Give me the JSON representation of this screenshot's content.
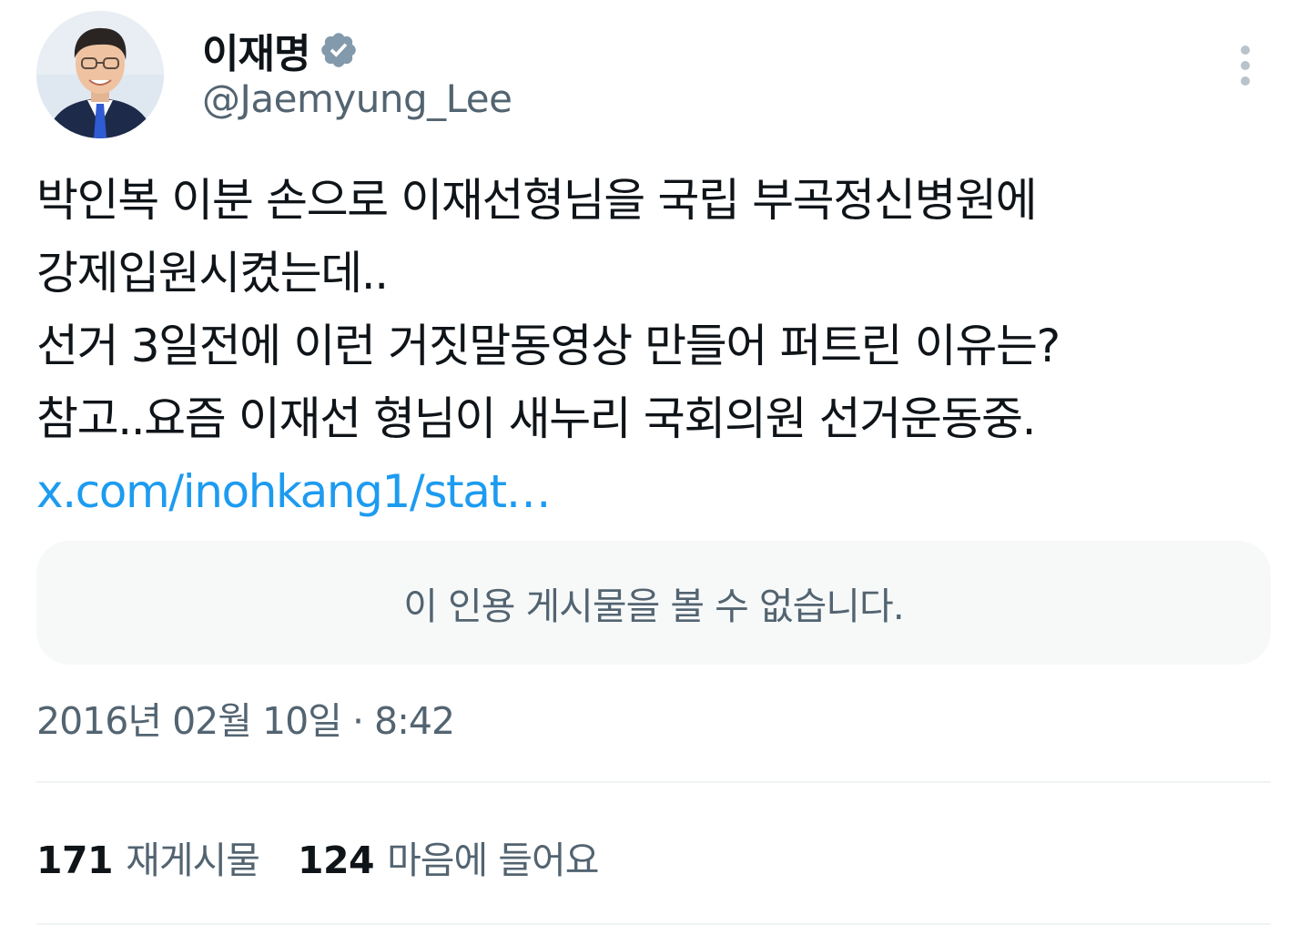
{
  "author": {
    "display_name": "이재명",
    "handle": "@Jaemyung_Lee",
    "avatar_icon": "profile-photo",
    "verified_icon": "verified-badge-icon",
    "verified_color": "#829aab"
  },
  "menu": {
    "icon": "more-vertical-icon"
  },
  "tweet": {
    "lines": [
      "박인복 이분 손으로 이재선형님을 국립 부곡정신병원에",
      "강제입원시켰는데..",
      "선거 3일전에 이런 거짓말동영상 만들어 퍼트린 이유는?",
      "참고..요즘 이재선 형님이 새누리 국회의원  선거운동중."
    ],
    "link": "x.com/inohkang1/stat…",
    "link_color": "#1d9bf0"
  },
  "quote": {
    "unavailable_text": "이 인용 게시물을 볼 수 없습니다."
  },
  "timestamp": "2016년 02월 10일 · 8:42",
  "stats": {
    "reposts_count": "171",
    "reposts_label": "재게시물",
    "likes_count": "124",
    "likes_label": "마음에 들어요"
  }
}
